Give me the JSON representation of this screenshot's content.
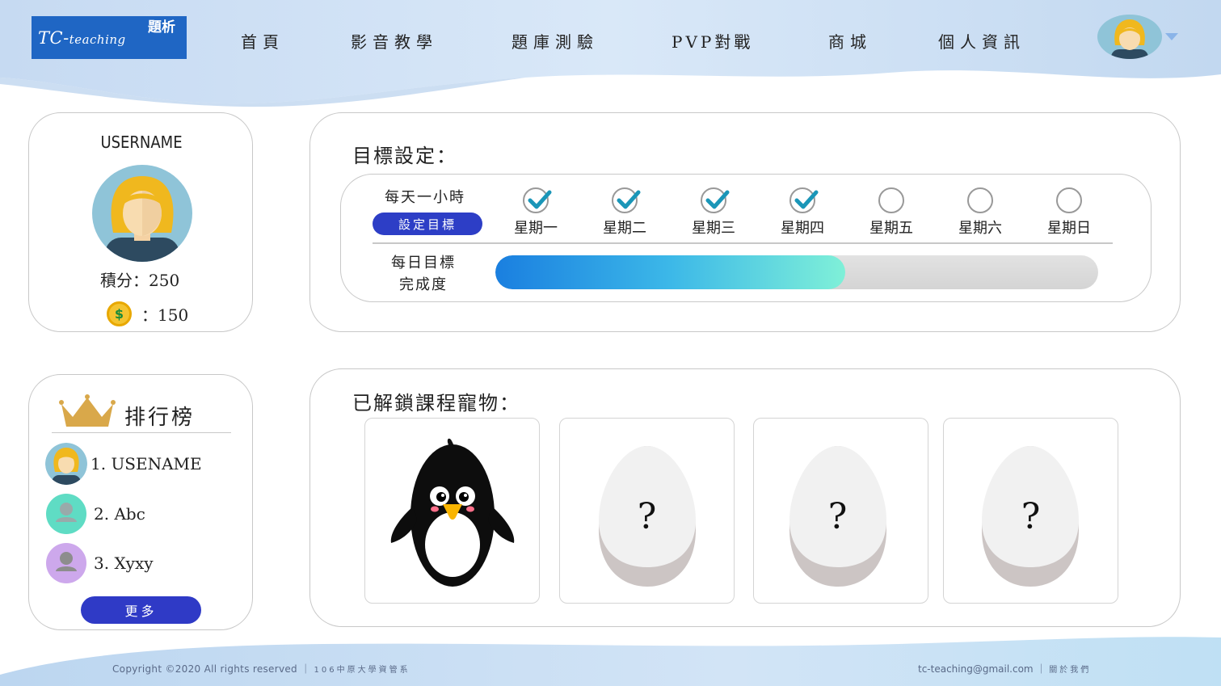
{
  "logo": {
    "brand": "TC-",
    "brand_sub": "teaching",
    "cn": "題析"
  },
  "nav": [
    {
      "label": "首頁"
    },
    {
      "label": "影音教學"
    },
    {
      "label": "題庫測驗"
    },
    {
      "label": "PVP對戰"
    },
    {
      "label": "商城"
    },
    {
      "label": "個人資訊"
    }
  ],
  "profile": {
    "username": "USERNAME",
    "points_label": "積分：250",
    "coins_label": "：150",
    "coin_symbol": "$"
  },
  "goal": {
    "title": "目標設定：",
    "target_text": "每天一小時",
    "set_button": "設定目標",
    "days": [
      {
        "label": "星期一",
        "done": true
      },
      {
        "label": "星期二",
        "done": true
      },
      {
        "label": "星期三",
        "done": true
      },
      {
        "label": "星期四",
        "done": true
      },
      {
        "label": "星期五",
        "done": false
      },
      {
        "label": "星期六",
        "done": false
      },
      {
        "label": "星期日",
        "done": false
      }
    ],
    "progress_label_line1": "每日目標",
    "progress_label_line2": "完成度",
    "progress_fraction": 0.58
  },
  "ranking": {
    "title": "排行榜",
    "items": [
      {
        "name": "1. USENAME",
        "avatar": "user-avatar"
      },
      {
        "name": "2. Abc",
        "avatar": "default-avatar",
        "bg": "#5fdcc4"
      },
      {
        "name": "3. Xyxy",
        "avatar": "default-avatar",
        "bg": "#cda8ec"
      }
    ],
    "more_button": "更多"
  },
  "pets": {
    "title": "已解鎖課程寵物：",
    "slots": [
      {
        "type": "penguin"
      },
      {
        "type": "egg",
        "mark": "?"
      },
      {
        "type": "egg",
        "mark": "?"
      },
      {
        "type": "egg",
        "mark": "?"
      }
    ]
  },
  "footer": {
    "copyright": "Copyright ©2020 All rights reserved ｜ ",
    "org": "106中原大學資管系",
    "email": "tc-teaching@gmail.com ｜ ",
    "about": "關於我們"
  },
  "colors": {
    "brand_blue": "#1f66c4",
    "button_indigo": "#2d3ec6",
    "check_teal": "#1a96b8"
  }
}
